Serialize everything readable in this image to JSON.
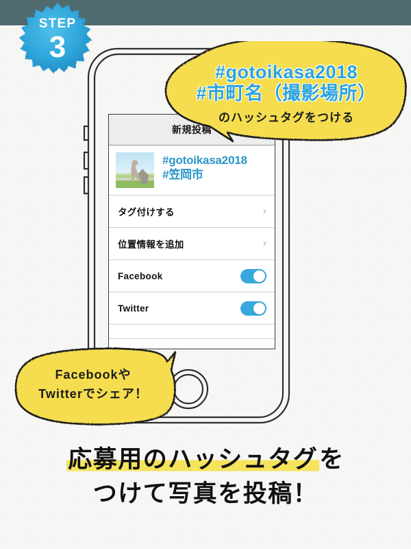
{
  "theme": {
    "band_color": "#4f6b70",
    "badge_blue": "#2b9fd4",
    "accent_blue": "#2aa3dd",
    "link_blue": "#2a96c8",
    "bubble_yellow": "#f6dd4e",
    "highlight_yellow": "#f6e35c",
    "paper": "#f6f6f4",
    "toggle_on": "#38a8dc"
  },
  "step_badge": {
    "label": "STEP",
    "number": "3",
    "icon": "starburst-badge-icon"
  },
  "top_bubble": {
    "line1": "#gotoikasa2018",
    "line2": "#市町名（撮影場所）",
    "line3": "のハッシュタグをつける"
  },
  "bottom_bubble": {
    "line1": "Facebookや",
    "line2": "Twitterでシェア！"
  },
  "phone": {
    "device_icon": "smartphone-outline-icon",
    "home_button_icon": "home-button-icon",
    "side_buttons": [
      "mute-switch",
      "volume-up-button",
      "volume-down-button"
    ],
    "screen": {
      "header": {
        "title": "新規投稿"
      },
      "caption_row": {
        "thumbnail_icon": "dinosaur-statue-photo-thumbnail",
        "caption_lines": [
          "#gotoikasa2018",
          "#笠岡市"
        ]
      },
      "rows": [
        {
          "label": "タグ付けする",
          "type": "chevron",
          "chevron": "›",
          "name": "tag-people-row"
        },
        {
          "label": "位置情報を追加",
          "type": "chevron",
          "chevron": "›",
          "name": "add-location-row"
        },
        {
          "label": "Facebook",
          "type": "toggle",
          "state": "on",
          "name": "facebook-share-row"
        },
        {
          "label": "Twitter",
          "type": "toggle",
          "state": "on",
          "name": "twitter-share-row"
        }
      ]
    }
  },
  "bottom_caption": {
    "line1_highlight": "応募用のハッシュタグ",
    "line1_tail": "を",
    "line2": "つけて写真を投稿！"
  }
}
